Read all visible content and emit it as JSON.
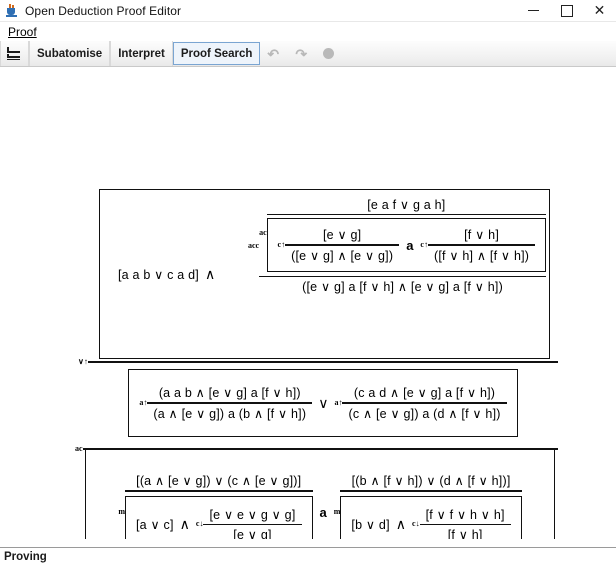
{
  "window": {
    "title": "Open Deduction Proof Editor",
    "icon": "java-coffee-cup-icon",
    "controls": {
      "minimize": "—",
      "maximize": "□",
      "close": "✕"
    }
  },
  "menubar": {
    "items": [
      {
        "label": "Proof",
        "mnemonic": "P"
      }
    ]
  },
  "toolbar": {
    "buttons": [
      {
        "name": "proof-tree-icon",
        "label": "",
        "icon": "proof-tree-icon",
        "state": "enabled"
      },
      {
        "name": "subatomise-button",
        "label": "Subatomise",
        "icon": "",
        "state": "enabled"
      },
      {
        "name": "interpret-button",
        "label": "Interpret",
        "icon": "",
        "state": "enabled"
      },
      {
        "name": "proof-search-button",
        "label": "Proof Search",
        "icon": "",
        "state": "pressed"
      },
      {
        "name": "undo-button",
        "label": "↶",
        "icon": "undo-icon",
        "state": "disabled"
      },
      {
        "name": "redo-button",
        "label": "↷",
        "icon": "redo-icon",
        "state": "disabled"
      },
      {
        "name": "stop-button",
        "label": "",
        "icon": "circle-icon",
        "state": "disabled"
      }
    ]
  },
  "statusbar": {
    "text": "Proving"
  },
  "proof": {
    "block1": {
      "label_left": "[a a b ∨ c a d]",
      "connective": "∧",
      "outer_rule_label": "acc",
      "outer_premise_label": "ac",
      "top_formula": "[e a f ∨ g a h]",
      "conclusion": "([e ∨ g] a [f ∨ h] ∧ [e ∨ g] a [f ∨ h])",
      "inner_left": {
        "rule_label": "c↑",
        "premise": "[e ∨ g]",
        "conclusion": "([e ∨ g] ∧ [e ∨ g])"
      },
      "inner_connective": "a",
      "inner_right": {
        "rule_label": "c↑",
        "premise": "[f ∨ h]",
        "conclusion": "([f ∨ h] ∧ [f ∨ h])"
      }
    },
    "sep1_label": "∨↑",
    "block2": {
      "left": {
        "rule_label": "a↑",
        "premise": "(a a b ∧ [e ∨ g] a [f ∨ h])",
        "conclusion": "(a ∧ [e ∨ g]) a (b ∧ [f ∨ h])"
      },
      "connective": "∨",
      "right": {
        "rule_label": "a↑",
        "premise": "(c a d ∧ [e ∨ g] a [f ∨ h])",
        "conclusion": "(c ∧ [e ∨ g]) a (d ∧ [f ∨ h])"
      }
    },
    "sep2_label": "ac",
    "block3": {
      "left": {
        "rule_label": "m",
        "premise": "[(a ∧ [e ∨ g]) ∨ (c ∧ [e ∨ g])]",
        "inner_left_formula": "[a ∨ c]",
        "inner_connective": "∧",
        "inner_rule_label": "c↓",
        "inner_premise": "[e ∨ e ∨ g ∨ g]",
        "inner_conclusion": "[e ∨ g]"
      },
      "connective": "a",
      "right": {
        "rule_label": "m",
        "premise": "[(b ∧ [f ∨ h]) ∨ (d ∧ [f ∨ h])]",
        "inner_left_formula": "[b ∨ d]",
        "inner_connective": "∧",
        "inner_rule_label": "c↓",
        "inner_premise": "[f ∨ f ∨ h ∨ h]",
        "inner_conclusion": "[f ∨ h]"
      }
    }
  },
  "colors": {
    "accent": "#7aa5d2",
    "toolbar_bg": "#f2f2f2",
    "ink": "#111111",
    "label_ink": "#1b1b1b"
  }
}
